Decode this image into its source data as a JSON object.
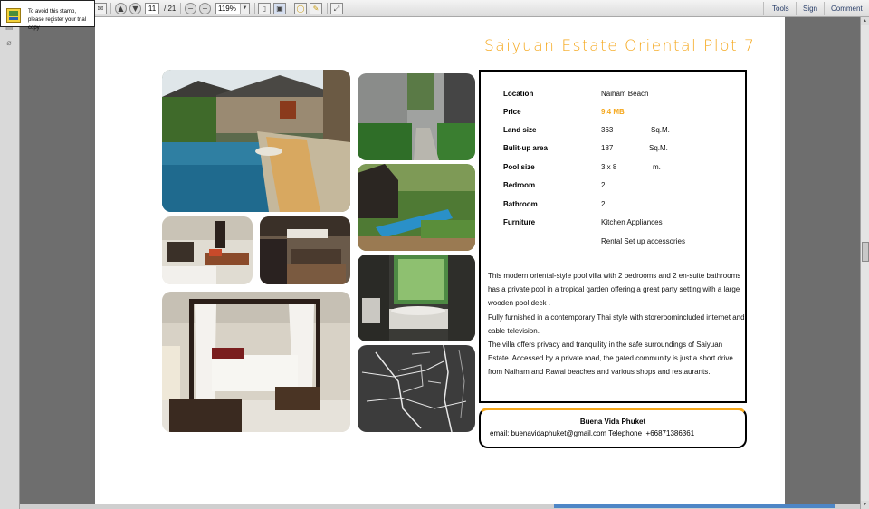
{
  "toolbar": {
    "page_current": "11",
    "page_total": "/ 21",
    "zoom": "119%",
    "links": [
      "Tools",
      "Sign",
      "Comment"
    ]
  },
  "stamp_notice": "To avoid this stamp, please register your trial copy",
  "page": {
    "title": "Saiyuan Estate Oriental Plot 7",
    "details": [
      {
        "label": "Location",
        "value": "Naiham Beach",
        "unit": ""
      },
      {
        "label": "Price",
        "value": "9.4 MB",
        "unit": ""
      },
      {
        "label": "Land size",
        "value": "363",
        "unit": "Sq.M."
      },
      {
        "label": "Bulit-up area",
        "value": "187",
        "unit": "Sq.M."
      },
      {
        "label": "Pool size",
        "value": "3 x 8",
        "unit": "m."
      },
      {
        "label": "Bedroom",
        "value": "2",
        "unit": ""
      },
      {
        "label": "Bathroom",
        "value": "2",
        "unit": ""
      },
      {
        "label": "Furniture",
        "value": "Kitchen Appliances",
        "unit": ""
      },
      {
        "label": "",
        "value": "Rental Set up accessories",
        "unit": ""
      }
    ],
    "description": [
      "This modern oriental-style pool villa with 2 bedrooms and 2 en-suite bathrooms has a private pool in a tropical garden offering a great party setting with a large wooden pool deck .",
      "Fully furnished in a contemporary Thai style with storeroomincluded internet and cable television.",
      "The villa offers privacy and tranquility in the safe surroundings of Saiyuan Estate. Accessed by a private road, the gated community is just a short drive from Naiham and Rawai beaches and various shops and restaurants."
    ],
    "contact": {
      "name": "Buena Vida Phuket",
      "line": "email: buenavidaphuket@gmail.com    Telephone :+66871386361"
    }
  },
  "colors": {
    "accent": "#f5a71b",
    "viewer_bg": "#6e6e6e"
  }
}
